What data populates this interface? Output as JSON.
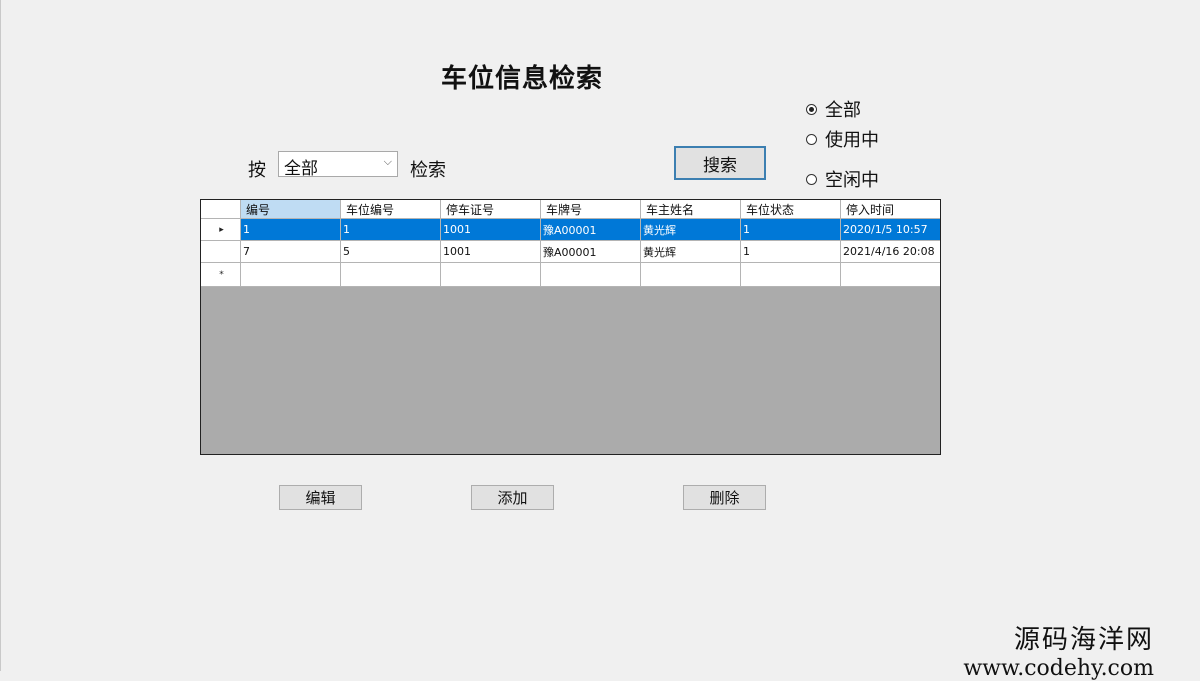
{
  "window": {
    "title": "车位信息检索"
  },
  "search": {
    "by_label": "按",
    "field_value": "全部",
    "after_label": "检索",
    "search_button": "搜索"
  },
  "filter": {
    "options": [
      {
        "label": "全部",
        "checked": true
      },
      {
        "label": "使用中",
        "checked": false
      },
      {
        "label": "空闲中",
        "checked": false
      }
    ]
  },
  "table": {
    "columns": [
      "编号",
      "车位编号",
      "停车证号",
      "车牌号",
      "车主姓名",
      "车位状态",
      "停入时间"
    ],
    "rows": [
      [
        "1",
        "1",
        "1001",
        "豫A00001",
        "黄光辉",
        "1",
        "2020/1/5 10:57"
      ],
      [
        "7",
        "5",
        "1001",
        "豫A00001",
        "黄光辉",
        "1",
        "2021/4/16 20:08"
      ]
    ],
    "current_row_marker": "▸",
    "new_row_marker": "*"
  },
  "actions": {
    "edit": "编辑",
    "add": "添加",
    "delete": "删除"
  },
  "watermark": {
    "line1": "源码海洋网",
    "line2": "www.codehy.com"
  }
}
